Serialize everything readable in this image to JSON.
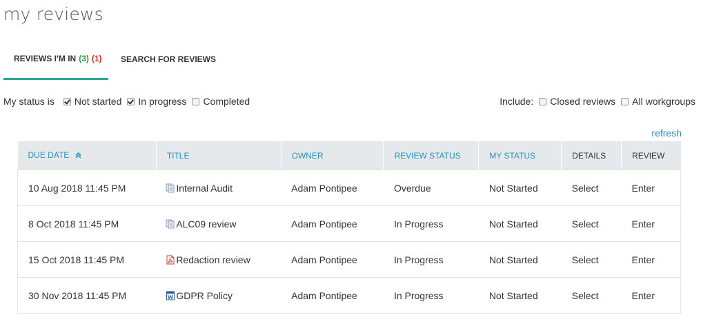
{
  "page": {
    "title": "my reviews"
  },
  "tabs": [
    {
      "label": "REVIEWS I'M IN",
      "count_a": "(3)",
      "count_b": "(1)",
      "active": true
    },
    {
      "label": "SEARCH FOR REVIEWS",
      "active": false
    }
  ],
  "filters": {
    "status_label": "My status is",
    "status_options": [
      {
        "label": "Not started",
        "checked": true
      },
      {
        "label": "In progress",
        "checked": true
      },
      {
        "label": "Completed",
        "checked": false
      }
    ],
    "include_label": "Include:",
    "include_options": [
      {
        "label": "Closed reviews",
        "checked": false
      },
      {
        "label": "All workgroups",
        "checked": false
      }
    ]
  },
  "refresh_label": "refresh",
  "table": {
    "columns": [
      "DUE DATE",
      "TITLE",
      "OWNER",
      "REVIEW STATUS",
      "MY STATUS",
      "DETAILS",
      "REVIEW"
    ],
    "sort_icon": "sort-up-double-chevron-icon",
    "rows": [
      {
        "due": "10 Aug 2018 11:45 PM",
        "icon": "document-stack-icon",
        "title": "Internal Audit",
        "owner": "Adam Pontipee",
        "review_status": "Overdue",
        "my_status": "Not Started",
        "details": "Select",
        "review": "Enter"
      },
      {
        "due": "8 Oct 2018 11:45 PM",
        "icon": "document-stack-icon",
        "title": "ALC09 review",
        "owner": "Adam Pontipee",
        "review_status": "In Progress",
        "my_status": "Not Started",
        "details": "Select",
        "review": "Enter"
      },
      {
        "due": "15 Oct 2018 11:45 PM",
        "icon": "pdf-file-icon",
        "title": "Redaction review",
        "owner": "Adam Pontipee",
        "review_status": "In Progress",
        "my_status": "Not Started",
        "details": "Select",
        "review": "Enter"
      },
      {
        "due": "30 Nov 2018 11:45 PM",
        "icon": "word-document-icon",
        "title": "GDPR Policy",
        "owner": "Adam Pontipee",
        "review_status": "In Progress",
        "my_status": "Not Started",
        "details": "Select",
        "review": "Enter"
      }
    ]
  },
  "colors": {
    "accent_teal": "#2aa792",
    "link_blue": "#2a8fbd",
    "count_green": "#2e9b4b",
    "count_red": "#d9261c",
    "header_bg": "#e6e9ec"
  }
}
